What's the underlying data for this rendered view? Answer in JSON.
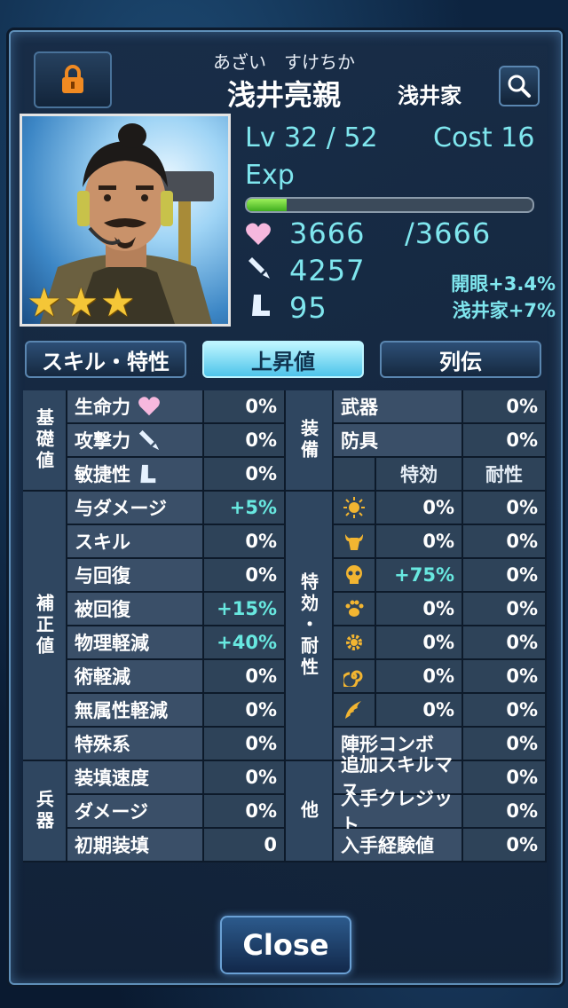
{
  "header": {
    "furigana": "あざい　すけちか",
    "name": "浅井亮親",
    "clan": "浅井家"
  },
  "stats": {
    "level": "Lv 32 / 52",
    "cost": "Cost 16",
    "exp_label": "Exp",
    "exp_fraction": 0.14,
    "hp_current": "3666",
    "hp_max": "/3666",
    "attack": "4257",
    "speed": "95",
    "bonus_kaigan": "開眼+3.4%",
    "bonus_clan": "浅井家+7%"
  },
  "tabs": [
    "スキル・特性",
    "上昇値",
    "列伝"
  ],
  "active_tab": "上昇値",
  "table": {
    "cat_base": "基礎値",
    "cat_correction": "補正値",
    "cat_weapon": "兵器",
    "cat_equip": "装備",
    "cat_special": "特効・耐性",
    "cat_other": "他",
    "header_tokko": "特効",
    "header_taisei": "耐性",
    "left_rows": [
      {
        "label": "生命力",
        "value": "0%"
      },
      {
        "label": "攻撃力",
        "value": "0%"
      },
      {
        "label": "敏捷性",
        "value": "0%"
      },
      {
        "label": "与ダメージ",
        "value": "+5%"
      },
      {
        "label": "スキル",
        "value": "0%"
      },
      {
        "label": "与回復",
        "value": "0%"
      },
      {
        "label": "被回復",
        "value": "+15%"
      },
      {
        "label": "物理軽減",
        "value": "+40%"
      },
      {
        "label": "術軽減",
        "value": "0%"
      },
      {
        "label": "無属性軽減",
        "value": "0%"
      },
      {
        "label": "特殊系",
        "value": "0%"
      },
      {
        "label": "装填速度",
        "value": "0%"
      },
      {
        "label": "ダメージ",
        "value": "0%"
      },
      {
        "label": "初期装填",
        "value": "0"
      }
    ],
    "equip_rows": [
      {
        "label": "武器",
        "value": "0%"
      },
      {
        "label": "防具",
        "value": "0%"
      }
    ],
    "special_rows": [
      {
        "icon": "sun-icon",
        "tokko": "0%",
        "taisei": "0%"
      },
      {
        "icon": "bull-head-icon",
        "tokko": "0%",
        "taisei": "0%"
      },
      {
        "icon": "skull-icon",
        "tokko": "+75%",
        "taisei": "0%"
      },
      {
        "icon": "paw-icon",
        "tokko": "0%",
        "taisei": "0%"
      },
      {
        "icon": "gear-icon",
        "tokko": "0%",
        "taisei": "0%"
      },
      {
        "icon": "spiral-icon",
        "tokko": "0%",
        "taisei": "0%"
      },
      {
        "icon": "wing-icon",
        "tokko": "0%",
        "taisei": "0%"
      }
    ],
    "other_rows": [
      {
        "label": "陣形コンボ",
        "value": "0%"
      },
      {
        "label": "追加スキルマス",
        "value": "0%"
      },
      {
        "label": "入手クレジット",
        "value": "0%"
      },
      {
        "label": "入手経験値",
        "value": "0%"
      }
    ]
  },
  "close_label": "Close",
  "colors": {
    "accent": "#7fe6ee",
    "panel": "#2e4359",
    "tab_active": "#4ec4ea"
  }
}
